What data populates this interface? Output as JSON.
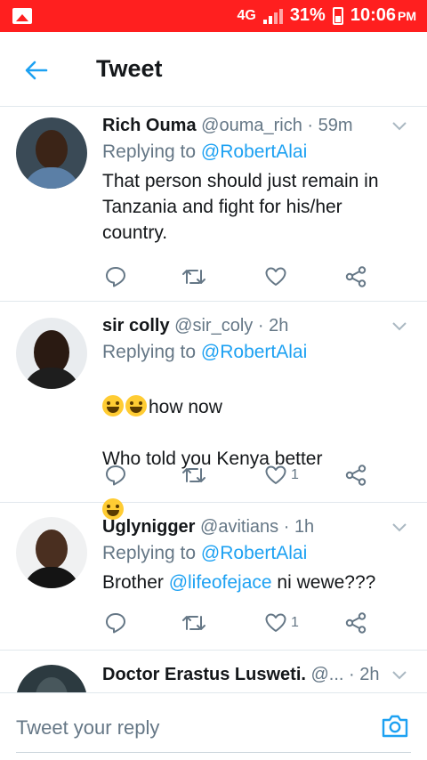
{
  "status_bar": {
    "network": "4G",
    "battery_percent": "31%",
    "time": "10:06",
    "ampm": "PM",
    "bar_color": "#ff1f1f"
  },
  "header": {
    "title": "Tweet",
    "back_icon": "arrow-left-icon"
  },
  "colors": {
    "accent": "#1da1f2",
    "secondary_text": "#657786",
    "divider": "#e1e8ed"
  },
  "tweets": [
    {
      "name": "Rich Ouma",
      "handle": "@ouma_rich",
      "dot": "·",
      "time": "59m",
      "reply_label": "Replying to",
      "reply_to": "@RobertAlai",
      "text": "That person should just remain in\nTanzania and fight for his/her\ncountry.",
      "like_count": ""
    },
    {
      "name": "sir colly",
      "handle": "@sir_coly",
      "dot": "·",
      "time": "2h",
      "reply_label": "Replying to",
      "reply_to": "@RobertAlai",
      "text_line1": "how now",
      "text_line2": "Who told you Kenya better",
      "like_count": "1"
    },
    {
      "name": "Uglynigger",
      "handle": "@avitians",
      "dot": "·",
      "time": "1h",
      "reply_label": "Replying to",
      "reply_to": "@RobertAlai",
      "text_prefix": "Brother ",
      "text_mention": "@lifeofejace",
      "text_suffix": " ni wewe???",
      "like_count": "1"
    },
    {
      "name": "Doctor Erastus Lusweti.",
      "handle": "@...",
      "dot": "·",
      "time": "2h"
    }
  ],
  "reply_bar": {
    "placeholder": "Tweet your reply",
    "camera_icon": "camera-icon"
  }
}
